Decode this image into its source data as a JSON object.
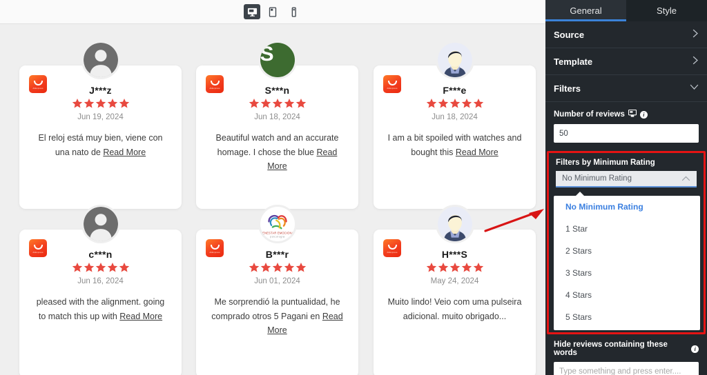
{
  "device_bar": {
    "devices": [
      {
        "name": "desktop",
        "icon": "desktop-icon",
        "active": true
      },
      {
        "name": "tablet",
        "icon": "tablet-icon",
        "active": false
      },
      {
        "name": "mobile",
        "icon": "mobile-icon",
        "active": false
      }
    ]
  },
  "reviews": [
    {
      "name": "J***z",
      "rating": 5,
      "date": "Jun 19, 2024",
      "text": "El reloj está muy bien, viene con una nato de ",
      "read_more": "Read More",
      "avatar_type": "silhouette",
      "source": "AliExpress"
    },
    {
      "name": "S***n",
      "rating": 5,
      "date": "Jun 18, 2024",
      "text": "Beautiful watch and an accurate homage. I chose the blue ",
      "read_more": "Read More",
      "avatar_type": "initial",
      "avatar_initial": "S",
      "source": "AliExpress"
    },
    {
      "name": "F***e",
      "rating": 5,
      "date": "Jun 18, 2024",
      "text": "I am a bit spoiled with watches and bought this ",
      "read_more": "Read More",
      "avatar_type": "person",
      "source": "AliExpress"
    },
    {
      "name": "c***n",
      "rating": 5,
      "date": "Jun 16, 2024",
      "text": "pleased with the alignment. going to match this up with ",
      "read_more": "Read More",
      "avatar_type": "silhouette",
      "source": "AliExpress"
    },
    {
      "name": "B***r",
      "rating": 5,
      "date": "Jun 01, 2024",
      "text": "Me sorprendió la puntualidad, he comprado otros 5 Pagani en ",
      "read_more": "Read More",
      "avatar_type": "logo",
      "avatar_logo_text": "BIENESTAR EMOCIONAL",
      "avatar_logo_subtext": "psicología",
      "source": "AliExpress"
    },
    {
      "name": "H***S",
      "rating": 5,
      "date": "May 24, 2024",
      "text": "Muito lindo! Veio com uma pulseira adicional. muito obrigado...",
      "read_more": "",
      "avatar_type": "person",
      "source": "AliExpress"
    }
  ],
  "panel": {
    "tabs": [
      {
        "label": "General",
        "active": true
      },
      {
        "label": "Style",
        "active": false
      }
    ],
    "sections": [
      {
        "label": "Source",
        "chevron": "chevron-right"
      },
      {
        "label": "Template",
        "chevron": "chevron-right"
      },
      {
        "label": "Filters",
        "chevron": "chevron-down"
      }
    ],
    "number_of_reviews": {
      "label": "Number of reviews",
      "value": "50",
      "has_responsive_icon": true,
      "has_info_icon": true
    },
    "rating_filter": {
      "label": "Filters by Minimum Rating",
      "selected": "No Minimum Rating",
      "chevron": "chevron-up",
      "options": [
        {
          "label": "No Minimum Rating",
          "selected": true
        },
        {
          "label": "1 Star",
          "selected": false
        },
        {
          "label": "2 Stars",
          "selected": false
        },
        {
          "label": "3 Stars",
          "selected": false
        },
        {
          "label": "4 Stars",
          "selected": false
        },
        {
          "label": "5 Stars",
          "selected": false
        }
      ]
    },
    "hide_words": {
      "label": "Hide reviews containing these words",
      "placeholder": "Type something and press enter....",
      "value": "",
      "has_info_icon": true
    }
  },
  "annotation": {
    "arrow_color": "#d81414",
    "highlight_color": "#e61414"
  },
  "colors": {
    "star": "#e8493f",
    "accent_blue": "#3b82d8",
    "panel_bg": "#23282d",
    "preview_bg": "#efefef"
  }
}
